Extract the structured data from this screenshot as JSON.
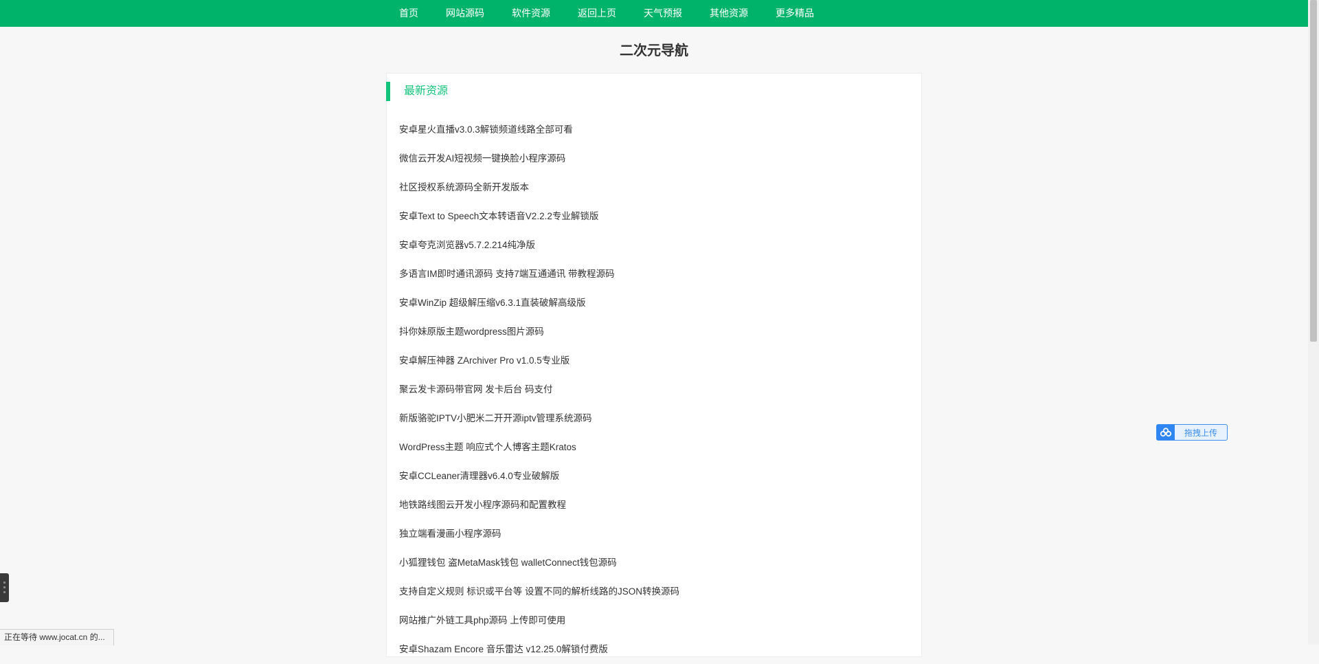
{
  "nav": {
    "items": [
      "首页",
      "网站源码",
      "软件资源",
      "返回上页",
      "天气预报",
      "其他资源",
      "更多精品"
    ]
  },
  "site_title": "二次元导航",
  "section": {
    "title": "最新资源",
    "items": [
      "安卓星火直播v3.0.3解锁频道线路全部可看",
      "微信云开发AI短视频一键换脸小程序源码",
      "社区授权系统源码全新开发版本",
      "安卓Text to Speech文本转语音V2.2.2专业解锁版",
      "安卓夸克浏览器v5.7.2.214纯净版",
      "多语言IM即时通讯源码 支持7端互通通讯 带教程源码",
      "安卓WinZip 超级解压缩v6.3.1直装破解高级版",
      "抖你妹原版主题wordpress图片源码",
      "安卓解压神器 ZArchiver Pro v1.0.5专业版",
      "聚云发卡源码带官网 发卡后台 码支付",
      "新版骆驼IPTV小肥米二开开源iptv管理系统源码",
      "WordPress主题 响应式个人博客主题Kratos",
      "安卓CCLeaner清理器v6.4.0专业破解版",
      "地铁路线图云开发小程序源码和配置教程",
      "独立端看漫画小程序源码",
      "小狐狸钱包 盗MetaMask钱包 walletConnect钱包源码",
      "支持自定义规则 标识或平台等 设置不同的解析线路的JSON转换源码",
      "网站推广外链工具php源码 上传即可使用",
      "安卓Shazam Encore 音乐雷达 v12.25.0解锁付费版"
    ]
  },
  "upload_widget": {
    "label": "拖拽上传",
    "icon": "baidu-cloud-icon"
  },
  "status_bar": {
    "text": "正在等待 www.jocat.cn 的..."
  },
  "colors": {
    "nav_bg": "#00b36b",
    "accent": "#13c37a",
    "upload_blue": "#2f86f2"
  }
}
